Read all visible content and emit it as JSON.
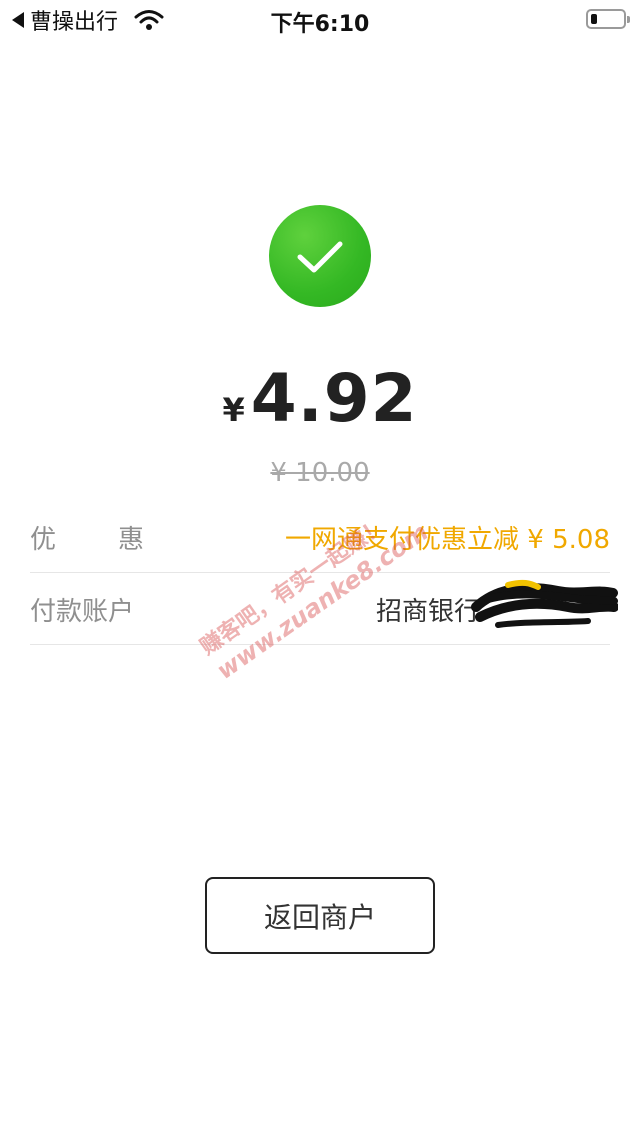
{
  "status_bar": {
    "back_app_label": "曹操出行",
    "time": "下午6:10",
    "battery_level": 0.2
  },
  "payment": {
    "currency_symbol": "¥",
    "amount": "4.92",
    "original_price": "¥ 10.00"
  },
  "rows": {
    "discount": {
      "label": "优惠",
      "value": "一网通支付优惠立减 ¥ 5.08"
    },
    "account": {
      "label": "付款账户",
      "value": "招商银行"
    }
  },
  "watermark": {
    "line1": "赚客吧，有实一起赚！",
    "line2": "www.zuanke8.com"
  },
  "actions": {
    "return_label": "返回商户"
  },
  "colors": {
    "success_green": "#34b824",
    "discount_orange": "#f0a800",
    "watermark_red": "#d84a4a"
  }
}
